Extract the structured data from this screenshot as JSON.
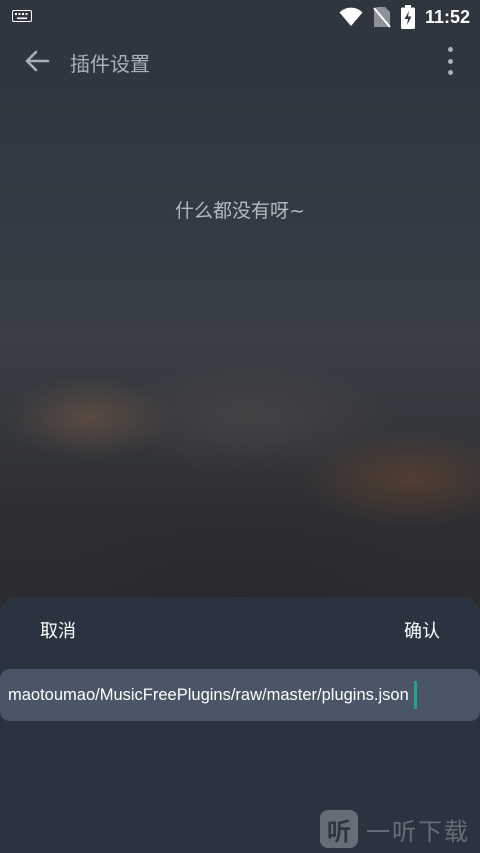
{
  "status_bar": {
    "time": "11:52",
    "icons": [
      "keyboard-icon",
      "wifi-icon",
      "no-sim-icon",
      "battery-charging-icon"
    ]
  },
  "app_bar": {
    "title": "插件设置",
    "back_icon": "arrow-left-icon",
    "menu_icon": "more-vertical-icon"
  },
  "main": {
    "empty_text": "什么都没有呀~"
  },
  "sheet": {
    "cancel_label": "取消",
    "confirm_label": "确认",
    "url_value": "maotoumao/MusicFreePlugins/raw/master/plugins.json"
  },
  "watermark": {
    "logo_char": "听",
    "text": "一听下载"
  },
  "colors": {
    "caret": "#19a889",
    "sheet_bg": "#2b3340",
    "input_bg": "#4a5567"
  }
}
